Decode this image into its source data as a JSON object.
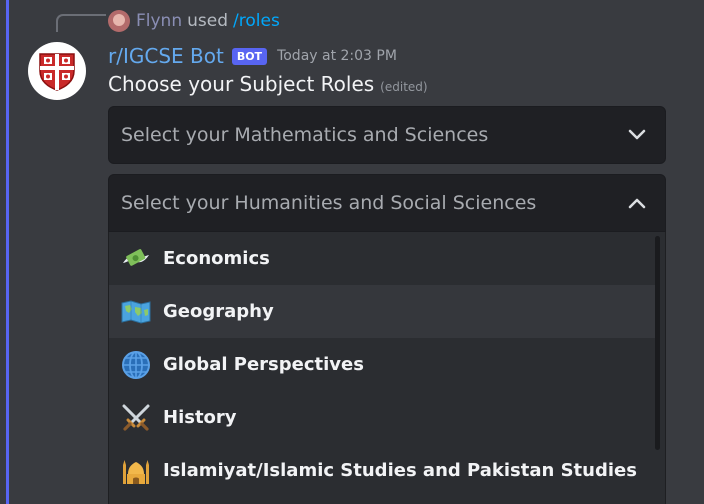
{
  "reply": {
    "user": "Flynn",
    "verb": "used",
    "command": "/roles"
  },
  "author": {
    "name": "r/IGCSE Bot",
    "tag": "BOT",
    "timestamp": "Today at 2:03 PM"
  },
  "message": {
    "text": "Choose your Subject Roles",
    "edited": "(edited)"
  },
  "selects": [
    {
      "placeholder": "Select your Mathematics and Sciences",
      "state": "collapsed",
      "icon": "chevron-down-icon"
    },
    {
      "placeholder": "Select your Humanities and Social Sciences",
      "state": "expanded",
      "icon": "chevron-up-icon"
    }
  ],
  "options": [
    {
      "label": "Economics",
      "icon": "money-with-wings-icon"
    },
    {
      "label": "Geography",
      "icon": "world-map-icon"
    },
    {
      "label": "Global Perspectives",
      "icon": "globe-icon"
    },
    {
      "label": "History",
      "icon": "crossed-swords-icon"
    },
    {
      "label": "Islamiyat/Islamic Studies and Pakistan Studies",
      "icon": "mosque-icon"
    }
  ],
  "colors": {
    "accent": "#5865f2",
    "bot_name": "#64a9ee",
    "link": "#00a8fc",
    "background": "#393b40"
  }
}
